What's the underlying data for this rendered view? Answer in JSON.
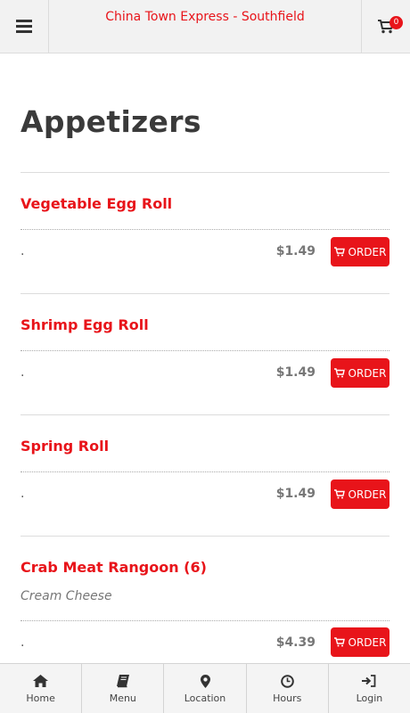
{
  "header": {
    "title": "China Town Express - Southfield",
    "cart_count": "0"
  },
  "page": {
    "title": "Appetizers"
  },
  "items": [
    {
      "name": "Vegetable Egg Roll",
      "description": "",
      "dot": ".",
      "price": "$1.49",
      "order_label": "ORDER"
    },
    {
      "name": "Shrimp Egg Roll",
      "description": "",
      "dot": ".",
      "price": "$1.49",
      "order_label": "ORDER"
    },
    {
      "name": "Spring Roll",
      "description": "",
      "dot": ".",
      "price": "$1.49",
      "order_label": "ORDER"
    },
    {
      "name": "Crab Meat Rangoon (6)",
      "description": "Cream Cheese",
      "dot": ".",
      "price": "$4.39",
      "order_label": "ORDER"
    }
  ],
  "bottom_nav": [
    {
      "label": "Home",
      "icon": "home-icon"
    },
    {
      "label": "Menu",
      "icon": "book-icon"
    },
    {
      "label": "Location",
      "icon": "map-pin-icon"
    },
    {
      "label": "Hours",
      "icon": "clock-icon"
    },
    {
      "label": "Login",
      "icon": "login-icon"
    }
  ],
  "colors": {
    "accent": "#e8141a",
    "header_bg": "#f2f2f2",
    "title_text": "#3a3a3a"
  }
}
